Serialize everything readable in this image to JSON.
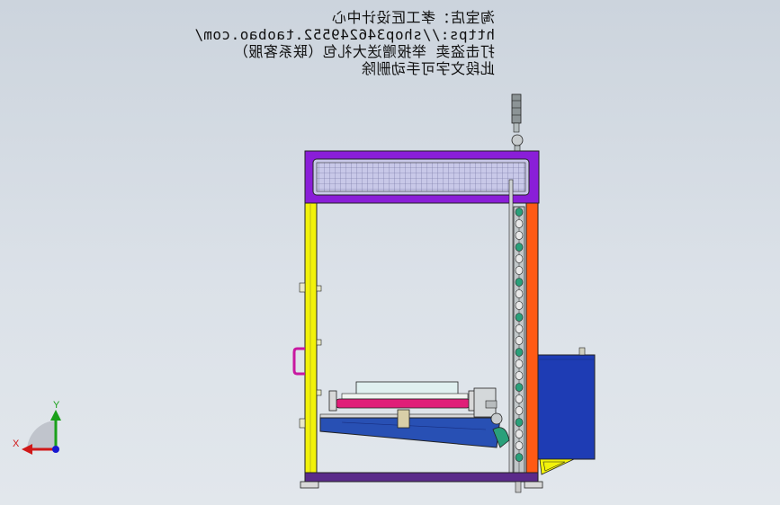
{
  "watermark": {
    "line1": "淘宝店：孝工匠设计中心",
    "line2": "https://shop346249552.taobao.com/",
    "line3": "打击盗卖 举报赠送大礼包（联系客服）",
    "line4": "此段文字可手动删除"
  },
  "triad": {
    "y_label": "Y",
    "x_label": "X"
  },
  "colors": {
    "frame_top": "#8a1ed8",
    "left_column": "#f2f20a",
    "right_column": "#ff5a14",
    "roller": "#e01e78",
    "table": "#2850b4",
    "cabinet": "#1e3cb4",
    "base": "#5a2a8a",
    "chain": "#2aa07a"
  }
}
